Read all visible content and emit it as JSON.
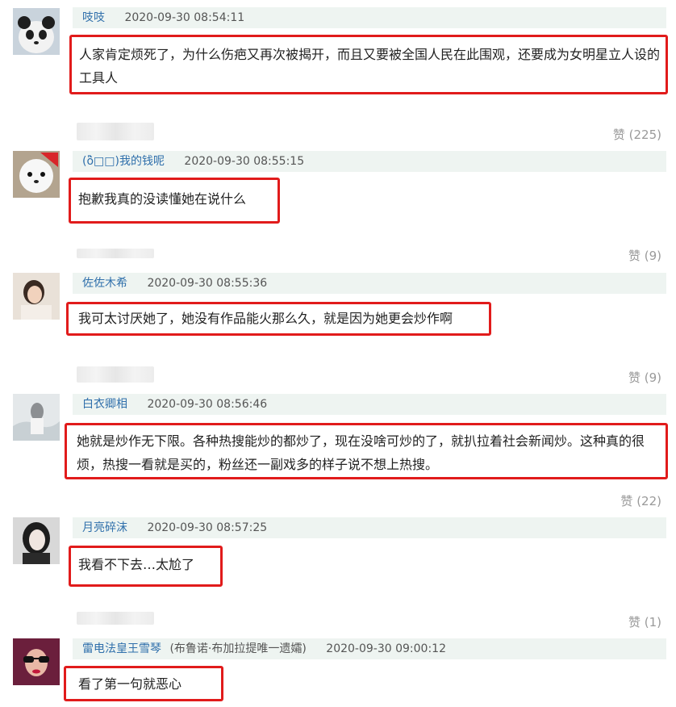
{
  "likes_label": "赞",
  "comments": [
    {
      "username": "吱吱",
      "extra": "",
      "timestamp": "2020-09-30 08:54:11",
      "text": "人家肯定烦死了，为什么伤疤又再次被揭开，而且又要被全国人民在此围观，还要成为女明星立人设的工具人",
      "likes": "(225)",
      "avatar_icon": "panda-avatar-icon"
    },
    {
      "username": "(ὃ̀□□)我的钱呢",
      "extra": "",
      "timestamp": "2020-09-30 08:55:15",
      "text": "抱歉我真的没读懂她在说什么",
      "likes": "(9)",
      "avatar_icon": "white-dog-avatar-icon"
    },
    {
      "username": "佐佐木希",
      "extra": "",
      "timestamp": "2020-09-30 08:55:36",
      "text": "我可太讨厌她了，她没有作品能火那么久，就是因为她更会炒作啊",
      "likes": "(9)",
      "avatar_icon": "woman-photo-avatar-icon"
    },
    {
      "username": "白衣卿相",
      "extra": "",
      "timestamp": "2020-09-30 08:56:46",
      "text": "她就是炒作无下限。各种热搜能炒的都炒了，现在没啥可炒的了，就扒拉着社会新闻炒。这种真的很烦，热搜一看就是买的，粉丝还一副戏多的样子说不想上热搜。",
      "likes": "(22)",
      "avatar_icon": "snow-scene-avatar-icon"
    },
    {
      "username": "月亮碎沫",
      "extra": "",
      "timestamp": "2020-09-30 08:57:25",
      "text": "我看不下去…太尬了",
      "likes": "(1)",
      "avatar_icon": "woman-bw-avatar-icon"
    },
    {
      "username": "雷电法皇王雪琴",
      "extra": "(布鲁诺·布加拉提唯一遗孀)",
      "timestamp": "2020-09-30 09:00:12",
      "text": "看了第一句就恶心",
      "likes": "",
      "avatar_icon": "sunglasses-avatar-icon"
    }
  ]
}
